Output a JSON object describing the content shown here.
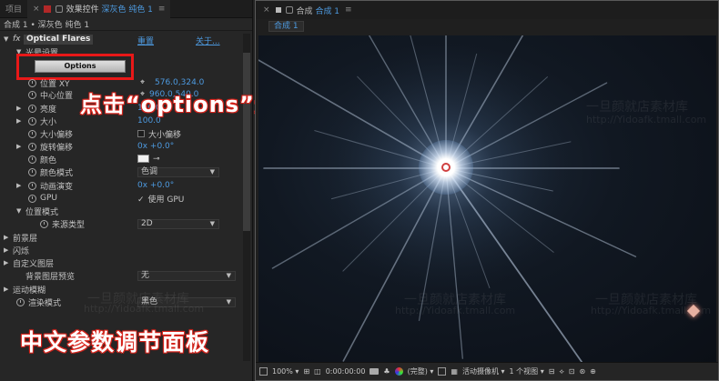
{
  "left_panel": {
    "tabs": [
      {
        "label": "项目"
      },
      {
        "label_prefix": "效果控件",
        "label_highlight": "深灰色 纯色 1"
      }
    ],
    "breadcrumb": "合成 1 • 深灰色 纯色 1",
    "effect": {
      "fx": "fx",
      "name": "Optical Flares",
      "reset": "重置",
      "about": "关于..."
    },
    "options_button": "Options",
    "properties": [
      {
        "label": "光晕设置"
      },
      {
        "label": "位置 XY",
        "value": "576.0,324.0"
      },
      {
        "label": "中心位置",
        "value": "960.0,540.0"
      },
      {
        "label": "亮度",
        "value": "100.0"
      },
      {
        "label": "大小",
        "value": "100.0"
      },
      {
        "label": "大小偏移",
        "checkbox_label": "大小偏移"
      },
      {
        "label": "旋转偏移",
        "value": "0x +0.0°"
      },
      {
        "label": "颜色"
      },
      {
        "label": "颜色模式",
        "dropdown": "色调"
      },
      {
        "label": "动画演变",
        "value": "0x +0.0°"
      },
      {
        "label": "GPU",
        "checkbox_label": "使用 GPU"
      },
      {
        "label": "位置模式"
      },
      {
        "label": "来源类型",
        "dropdown": "2D"
      },
      {
        "label": "前景层"
      },
      {
        "label": "闪烁"
      },
      {
        "label": "自定义图层"
      },
      {
        "label": "背景图层预览",
        "dropdown": "无"
      },
      {
        "label": "运动模糊"
      },
      {
        "label": "渲染模式",
        "dropdown": "黑色"
      }
    ]
  },
  "annotations": {
    "top": "点击“options”进入预设",
    "bottom": "中文参数调节面板"
  },
  "watermark": {
    "cn": "一旦颜就店素材库",
    "en": "http://Yidoafk.tmall.com"
  },
  "right_panel": {
    "tab": "合成",
    "tab_highlight": "合成 1",
    "comp_tab": "合成 1",
    "toolbar": {
      "zoom": "100%",
      "timecode": "0:00:00:00",
      "quality": "(完整)",
      "camera": "活动摄像机",
      "views": "1 个视图"
    }
  },
  "colors": {
    "accent_blue": "#4d9ae0",
    "annotation_red": "#d8261e",
    "highlight_box": "#e81818"
  }
}
